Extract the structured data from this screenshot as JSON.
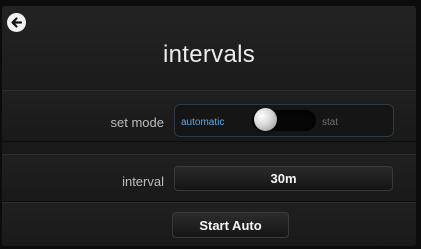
{
  "header": {
    "title": "intervals",
    "back_icon": "arrow-left-circle-icon"
  },
  "mode": {
    "label": "set mode",
    "option_on": "automatic",
    "option_off": "stat",
    "selected": "automatic",
    "active_color": "#5aa9e6"
  },
  "interval": {
    "label": "interval",
    "value": "30m"
  },
  "actions": {
    "start_label": "Start Auto"
  }
}
